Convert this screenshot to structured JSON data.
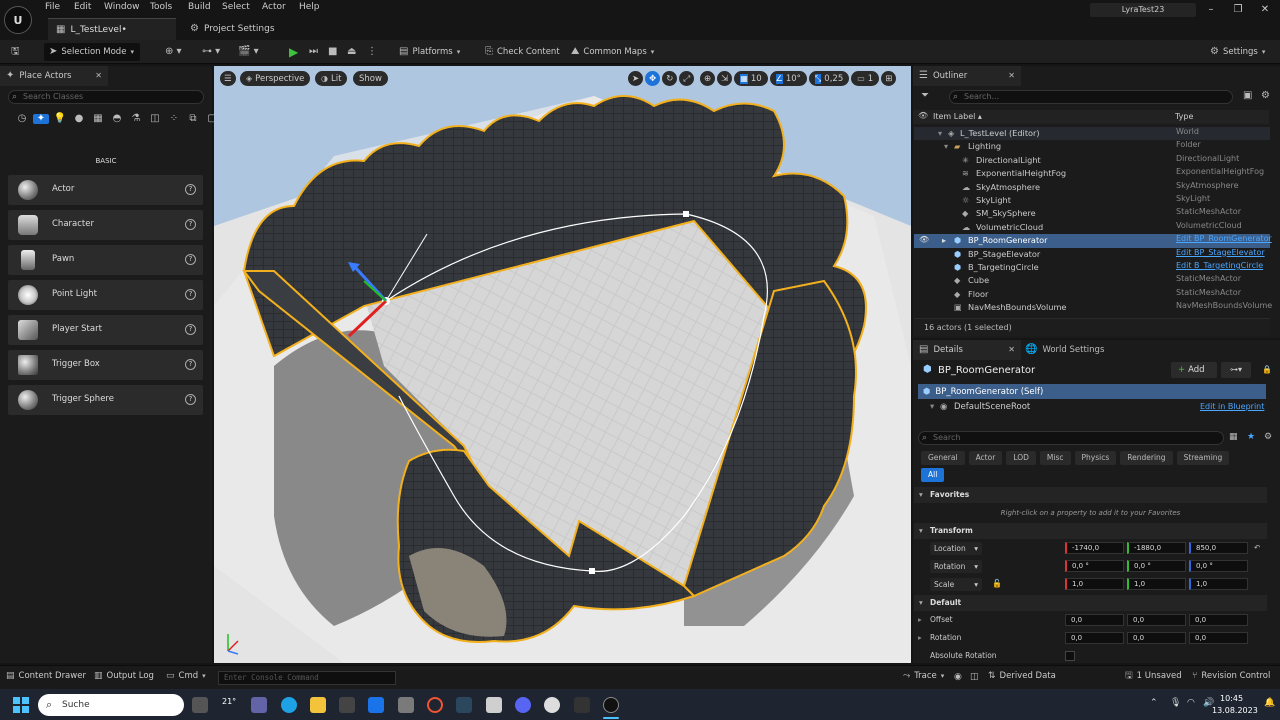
{
  "menu": [
    "File",
    "Edit",
    "Window",
    "Tools",
    "Build",
    "Select",
    "Actor",
    "Help"
  ],
  "document_tab": "L_TestLevel•",
  "project_settings": "Project Settings",
  "project_name": "LyraTest23",
  "toolbar": {
    "selection_mode": "Selection Mode",
    "platforms": "Platforms",
    "check_content": "Check Content",
    "common_maps": "Common Maps",
    "settings": "Settings"
  },
  "place_actors": {
    "tab": "Place Actors",
    "search_placeholder": "Search Classes",
    "category": "BASIC",
    "items": [
      "Actor",
      "Character",
      "Pawn",
      "Point Light",
      "Player Start",
      "Trigger Box",
      "Trigger Sphere"
    ]
  },
  "viewport": {
    "perspective": "Perspective",
    "lit": "Lit",
    "show": "Show",
    "grid_snap": "10",
    "rot_snap": "10°",
    "scale_snap": "0,25",
    "camera_speed": "1"
  },
  "outliner": {
    "tab": "Outliner",
    "search_placeholder": "Search...",
    "col_label": "Item Label ▴",
    "col_type": "Type",
    "rows": [
      {
        "label": "L_TestLevel (Editor)",
        "type": "World"
      },
      {
        "label": "Lighting",
        "type": "Folder"
      },
      {
        "label": "DirectionalLight",
        "type": "DirectionalLight"
      },
      {
        "label": "ExponentialHeightFog",
        "type": "ExponentialHeightFog"
      },
      {
        "label": "SkyAtmosphere",
        "type": "SkyAtmosphere"
      },
      {
        "label": "SkyLight",
        "type": "SkyLight"
      },
      {
        "label": "SM_SkySphere",
        "type": "StaticMeshActor"
      },
      {
        "label": "VolumetricCloud",
        "type": "VolumetricCloud"
      },
      {
        "label": "BP_RoomGenerator",
        "type": "Edit BP_RoomGenerator"
      },
      {
        "label": "BP_StageElevator",
        "type": "Edit BP_StageElevator"
      },
      {
        "label": "B_TargetingCircle",
        "type": "Edit B_TargetingCircle"
      },
      {
        "label": "Cube",
        "type": "StaticMeshActor"
      },
      {
        "label": "Floor",
        "type": "StaticMeshActor"
      },
      {
        "label": "NavMeshBoundsVolume",
        "type": "NavMeshBoundsVolume"
      }
    ],
    "count": "16 actors (1 selected)"
  },
  "details": {
    "tab": "Details",
    "world_settings_tab": "World Settings",
    "object_name": "BP_RoomGenerator",
    "add": "Add",
    "self_row": "BP_RoomGenerator (Self)",
    "root_row": "DefaultSceneRoot",
    "edit_bp": "Edit in Blueprint",
    "search_placeholder": "Search",
    "tabs": [
      "General",
      "Actor",
      "LOD",
      "Misc",
      "Physics",
      "Rendering",
      "Streaming"
    ],
    "all_tab": "All",
    "favorites": "Favorites",
    "favorites_hint": "Right-click on a property to add it to your Favorites",
    "transform": "Transform",
    "location_label": "Location",
    "location": [
      "-1740,0",
      "-1880,0",
      "850,0"
    ],
    "rotation_label": "Rotation",
    "rotation": [
      "0,0 °",
      "0,0 °",
      "0,0 °"
    ],
    "scale_label": "Scale",
    "scale": [
      "1,0",
      "1,0",
      "1,0"
    ],
    "default": "Default",
    "offset_label": "Offset",
    "offset": [
      "0,0",
      "0,0",
      "0,0"
    ],
    "rotation2_label": "Rotation",
    "rotation2": [
      "0,0",
      "0,0",
      "0,0"
    ],
    "absolute_rotation": "Absolute Rotation"
  },
  "statusbar": {
    "content_drawer": "Content Drawer",
    "output_log": "Output Log",
    "cmd": "Cmd",
    "console_placeholder": "Enter Console Command",
    "trace": "Trace",
    "derived_data": "Derived Data",
    "unsaved": "1 Unsaved",
    "revision_control": "Revision Control"
  },
  "taskbar": {
    "search": "Suche",
    "weather": "21°",
    "time": "10:45",
    "date": "13.08.2023"
  }
}
